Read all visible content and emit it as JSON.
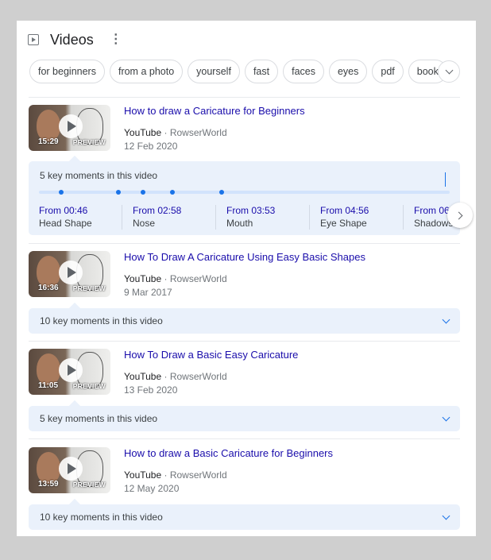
{
  "header": {
    "title": "Videos",
    "video_icon": "video-icon",
    "more_icon": "more-vert-icon"
  },
  "chips": [
    "for beginners",
    "from a photo",
    "yourself",
    "fast",
    "faces",
    "eyes",
    "pdf",
    "book"
  ],
  "chip_more_icon": "chevron-down-icon",
  "colors": {
    "link": "#1a0dab",
    "accent": "#1a73e8",
    "key_moments_bg": "#eaf1fb"
  },
  "videos": [
    {
      "title": "How to draw a Caricature for Beginners",
      "source": "YouTube",
      "channel": "RowserWorld",
      "date": "12 Feb 2020",
      "duration": "15:29",
      "preview_label": "PREVIEW",
      "key_moments": "5 key moments in this video",
      "expanded": true,
      "moments": [
        {
          "time": "From 00:46",
          "name": "Head Shape"
        },
        {
          "time": "From 02:58",
          "name": "Nose"
        },
        {
          "time": "From 03:53",
          "name": "Mouth"
        },
        {
          "time": "From 04:56",
          "name": "Eye Shape"
        },
        {
          "time": "From 06",
          "name": "Shadows"
        }
      ]
    },
    {
      "title": "How To Draw A Caricature Using Easy Basic Shapes",
      "source": "YouTube",
      "channel": "RowserWorld",
      "date": "9 Mar 2017",
      "duration": "16:36",
      "preview_label": "PREVIEW",
      "key_moments": "10 key moments in this video",
      "expanded": false
    },
    {
      "title": "How To Draw a Basic Easy Caricature",
      "source": "YouTube",
      "channel": "RowserWorld",
      "date": "13 Feb 2020",
      "duration": "11:05",
      "preview_label": "PREVIEW",
      "key_moments": "5 key moments in this video",
      "expanded": false
    },
    {
      "title": "How to draw a Basic Caricature for Beginners",
      "source": "YouTube",
      "channel": "RowserWorld",
      "date": "12 May 2020",
      "duration": "13:59",
      "preview_label": "PREVIEW",
      "key_moments": "10 key moments in this video",
      "expanded": false
    }
  ],
  "separator": "·"
}
